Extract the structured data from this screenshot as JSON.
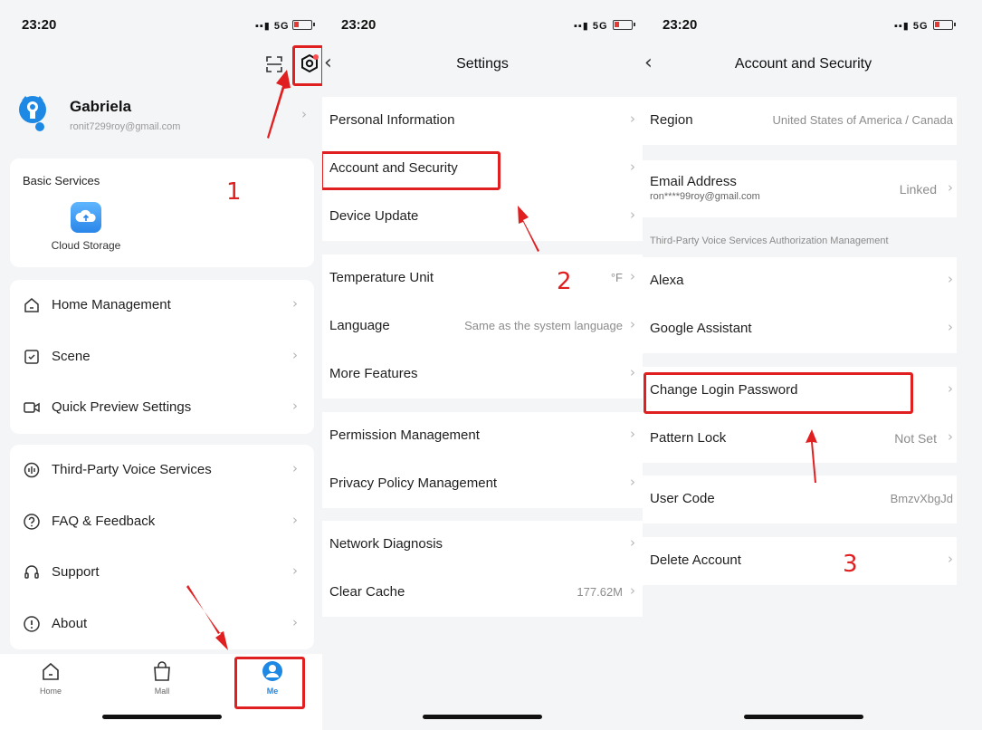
{
  "status_bar": {
    "time": "23:20",
    "network": "5G"
  },
  "me_screen": {
    "profile": {
      "name": "Gabriela",
      "email": "ronit7299roy@gmail.com"
    },
    "basic_services": {
      "title": "Basic Services",
      "items": [
        {
          "label": "Cloud Storage",
          "icon": "cloud-upload-icon"
        }
      ]
    },
    "menu_group_1": [
      {
        "label": "Home Management",
        "icon": "house-icon"
      },
      {
        "label": "Scene",
        "icon": "checkbox-icon"
      },
      {
        "label": "Quick Preview Settings",
        "icon": "camera-icon"
      }
    ],
    "menu_group_2": [
      {
        "label": "Third-Party Voice Services",
        "icon": "voice-icon"
      },
      {
        "label": "FAQ & Feedback",
        "icon": "question-icon"
      },
      {
        "label": "Support",
        "icon": "headset-icon"
      },
      {
        "label": "About",
        "icon": "info-icon"
      }
    ],
    "tabbar": [
      {
        "label": "Home",
        "icon": "home-tab-icon"
      },
      {
        "label": "Mall",
        "icon": "shopping-bag-icon"
      },
      {
        "label": "Me",
        "icon": "user-tab-icon",
        "active": true
      }
    ]
  },
  "settings_screen": {
    "title": "Settings",
    "group_1": [
      {
        "label": "Personal Information",
        "value": ""
      },
      {
        "label": "Account and Security",
        "value": ""
      },
      {
        "label": "Device Update",
        "value": ""
      }
    ],
    "group_2": [
      {
        "label": "Temperature Unit",
        "value": "°F"
      },
      {
        "label": "Language",
        "value": "Same as the system language"
      },
      {
        "label": "More Features",
        "value": ""
      }
    ],
    "group_3": [
      {
        "label": "Permission Management",
        "value": ""
      },
      {
        "label": "Privacy Policy Management",
        "value": ""
      }
    ],
    "group_4": [
      {
        "label": "Network Diagnosis",
        "value": ""
      },
      {
        "label": "Clear Cache",
        "value": "177.62M"
      }
    ]
  },
  "account_screen": {
    "title": "Account and Security",
    "region": {
      "label": "Region",
      "value": "United States of America / Canada"
    },
    "email": {
      "label": "Email Address",
      "sub": "ron****99roy@gmail.com",
      "value": "Linked"
    },
    "voice_section_header": "Third-Party Voice Services Authorization Management",
    "voice_items": [
      {
        "label": "Alexa"
      },
      {
        "label": "Google Assistant"
      }
    ],
    "change_password": {
      "label": "Change Login Password"
    },
    "pattern_lock": {
      "label": "Pattern Lock",
      "value": "Not Set"
    },
    "user_code": {
      "label": "User Code",
      "value": "BmzvXbgJd"
    },
    "delete_account": {
      "label": "Delete Account"
    }
  },
  "annotations": {
    "step_1": "1",
    "step_2": "2",
    "step_3": "3",
    "color": "#e02020"
  },
  "colors": {
    "accent": "#1e88e5",
    "annotation_red": "#e02020",
    "background": "#f4f5f7"
  }
}
